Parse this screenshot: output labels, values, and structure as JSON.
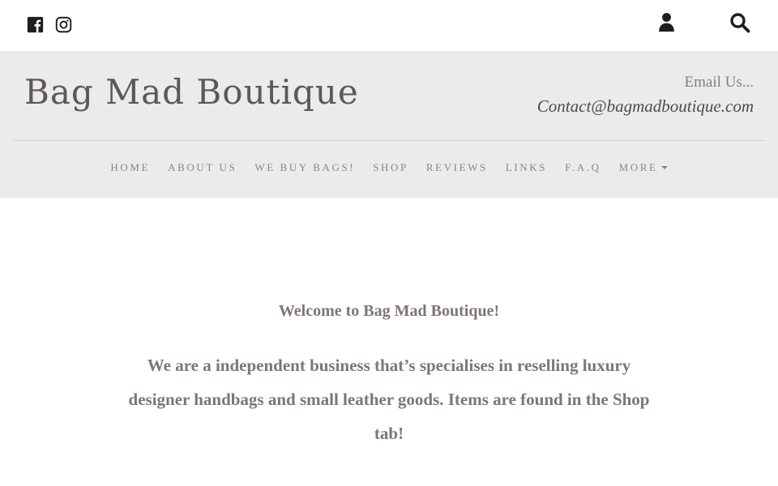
{
  "topbar": {
    "social_icons": [
      "facebook-icon",
      "instagram-icon"
    ],
    "right_icons": [
      "user-icon",
      "search-icon"
    ]
  },
  "header": {
    "site_title": "Bag Mad Boutique",
    "email_label": "Email Us...",
    "email_address": "Contact@bagmadboutique.com"
  },
  "nav": {
    "items": [
      {
        "label": "HOME"
      },
      {
        "label": "ABOUT US"
      },
      {
        "label": "WE BUY BAGS!"
      },
      {
        "label": "SHOP"
      },
      {
        "label": "REVIEWS"
      },
      {
        "label": "LINKS"
      },
      {
        "label": "F.A.Q"
      },
      {
        "label": "MORE"
      }
    ]
  },
  "content": {
    "welcome": "Welcome to Bag Mad Boutique!",
    "intro": "We are a independent business that’s specialises in reselling luxury designer handbags and small leather goods. Items are found in the Shop tab!"
  },
  "colors": {
    "header_bg": "#ebebeb",
    "text": "#7e7674",
    "title": "#5e5855"
  }
}
